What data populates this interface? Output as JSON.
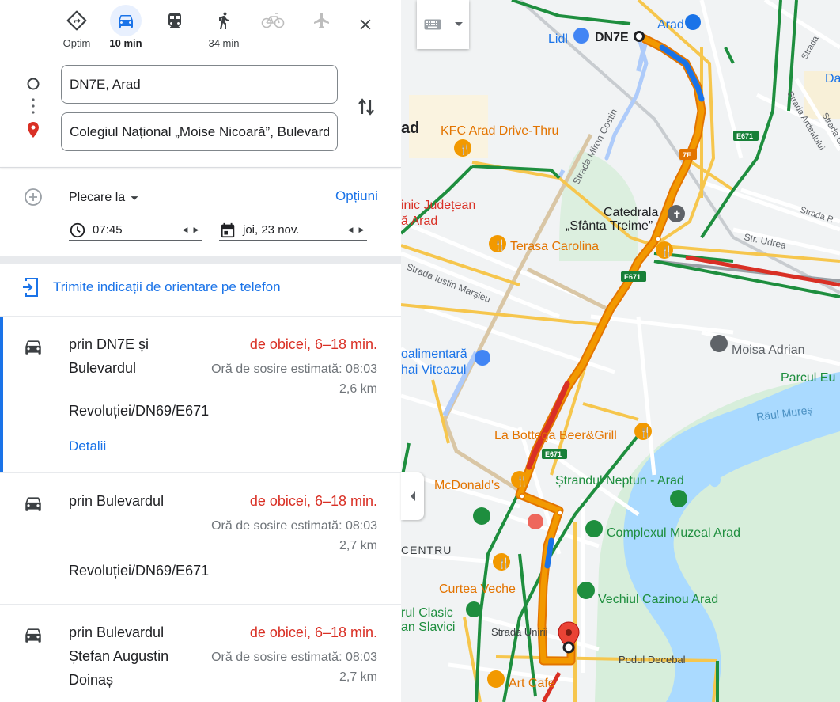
{
  "travel_modes": [
    {
      "name": "best",
      "label": "Optim",
      "icon": "directions-icon"
    },
    {
      "name": "driving",
      "label": "10 min",
      "icon": "car-icon",
      "active": true
    },
    {
      "name": "transit",
      "label": "",
      "icon": "train-icon"
    },
    {
      "name": "walking",
      "label": "34 min",
      "icon": "walk-icon"
    },
    {
      "name": "cycling",
      "label": "—",
      "icon": "bike-icon"
    },
    {
      "name": "flight",
      "label": "—",
      "icon": "plane-icon"
    }
  ],
  "origin": "DN7E, Arad",
  "destination": "Colegiul Național „Moise Nicoară”, Bulevardul Revoluției",
  "depart": {
    "label": "Plecare la",
    "time": "07:45",
    "date": "joi, 23 nov."
  },
  "options_label": "Opțiuni",
  "send_to_phone": "Trimite indicații de orientare pe telefon",
  "routes": [
    {
      "name": "prin DN7E și Bulevardul",
      "name2": "Revoluției/DN69/E671",
      "time": "de obicei, 6–18 min.",
      "eta": "Oră de sosire estimată: 08:03",
      "dist": "2,6 km",
      "details": "Detalii"
    },
    {
      "name": "prin Bulevardul",
      "name2": "Revoluției/DN69/E671",
      "time": "de obicei, 6–18 min.",
      "eta": "Oră de sosire estimată: 08:03",
      "dist": "2,7 km"
    },
    {
      "name": "prin Bulevardul Ștefan Augustin Doinaș",
      "time": "de obicei, 6–18 min.",
      "eta": "Oră de sosire estimată: 08:03",
      "dist": "2,7 km"
    }
  ],
  "map": {
    "labels": {
      "arad_station": "Arad",
      "lidl": "Lidl",
      "dn7e": "DN7E",
      "da": "Da",
      "ad": "ad",
      "kfc": "KFC Arad Drive-Thru",
      "miron": "Strada Miron Costin",
      "catedrala1": "Catedrala",
      "catedrala2": "„Sfânta Treime”",
      "terasa": "Terasa Carolina",
      "spital1": "inic Județean",
      "spital2": "ă Arad",
      "iustin": "Strada Iustin Marșieu",
      "udrea": "Str. Udrea",
      "moisa": "Moisa Adrian",
      "parcul": "Parcul Eu",
      "alimentara1": "oalimentară",
      "alimentara2": "hai Viteazul",
      "raul": "Râul Mureș",
      "bottega": "La Bottega Beer&Grill",
      "mcd": "McDonald's",
      "neptun": "Ștrandul Neptun - Arad",
      "complex": "Complexul Muzeal Arad",
      "centru": "CENTRU",
      "curtea": "Curtea Veche",
      "cazinou": "Vechiul Cazinou Arad",
      "clasic1": "rul Clasic",
      "clasic2": "an Slavici",
      "unirii": "Strada Unirii",
      "decebal": "Podul Decebal",
      "artcafe": "Art Cafe",
      "strada_arad1": "Strada",
      "strada_ardealului": "Strada Ardealului",
      "strada_gh": "Strada Gh",
      "strada_r": "Strada R"
    },
    "road_shields": [
      "E671",
      "7E",
      "E671",
      "E671"
    ]
  },
  "colors": {
    "accent": "#1a73e8",
    "traffic_red": "#d93025",
    "route_orange": "#f29900"
  }
}
